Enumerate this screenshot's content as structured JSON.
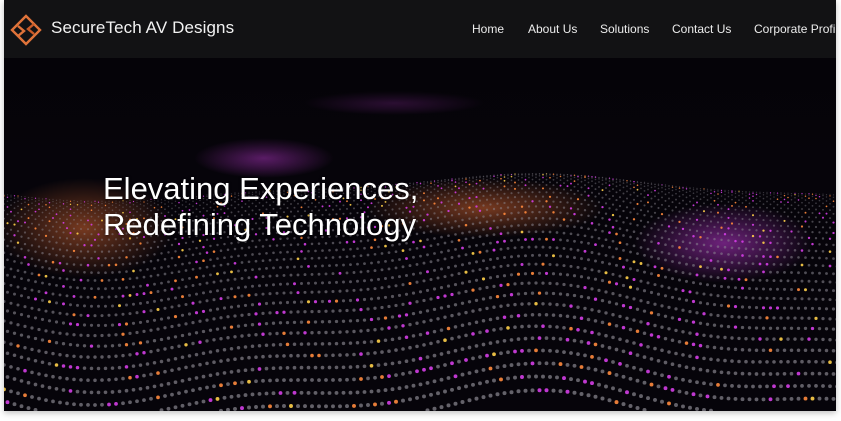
{
  "header": {
    "brand_name": "SecureTech AV Designs",
    "logo_icon": "diamond-chevron-logo-icon",
    "nav": [
      {
        "label": "Home"
      },
      {
        "label": "About Us"
      },
      {
        "label": "Solutions"
      },
      {
        "label": "Contact Us"
      },
      {
        "label": "Corporate Profile"
      }
    ]
  },
  "hero": {
    "headline_line1": "Elevating Experiences,",
    "headline_line2": "Redefining Technology",
    "background": "particle-wave-image"
  },
  "colors": {
    "navbar": "#121214",
    "background": "#050308",
    "logo_accent": "#e0733a",
    "text": "#ffffff",
    "particle_magenta": "#d43ee6",
    "particle_orange": "#ff8a3d"
  }
}
